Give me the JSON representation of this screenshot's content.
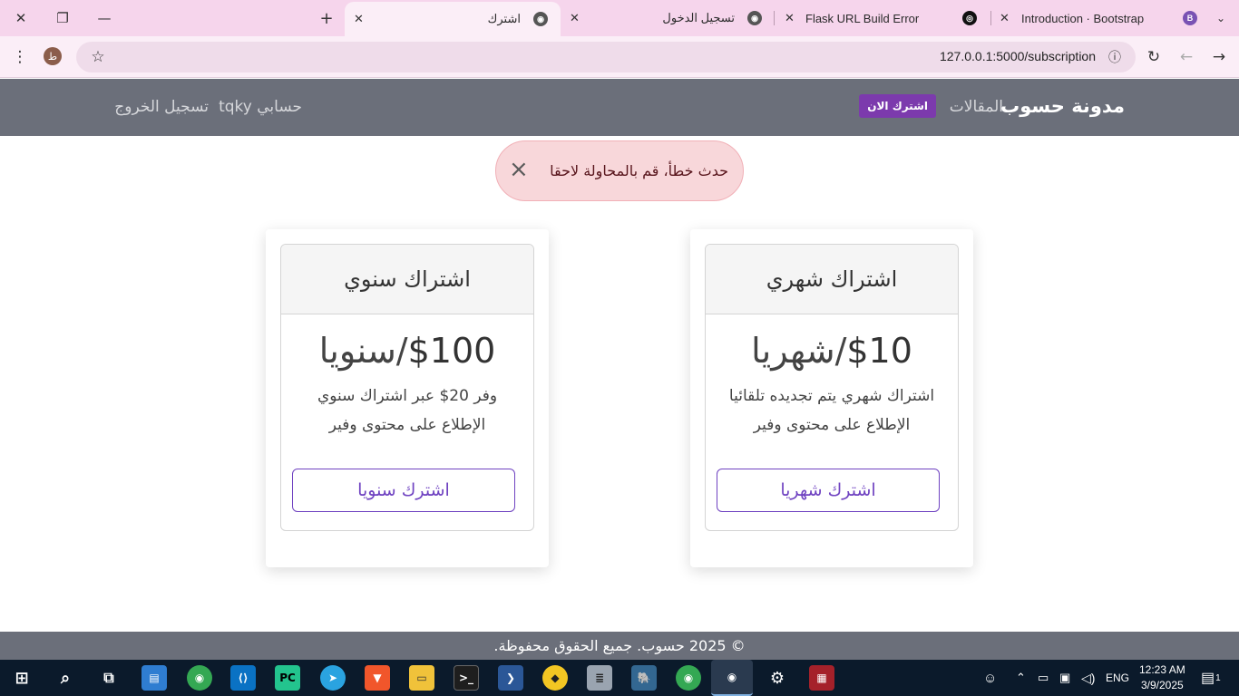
{
  "browser": {
    "tabs": [
      {
        "title": "اشترك",
        "active": true
      },
      {
        "title": "تسجيل الدخول",
        "active": false
      },
      {
        "title": "Flask URL Build Error",
        "active": false
      },
      {
        "title": "Introduction · Bootstrap",
        "active": false
      }
    ],
    "url": "127.0.0.1:5000/subscription",
    "profile_initial": "ط"
  },
  "navbar": {
    "brand": "مدونة حسوب",
    "articles": "المقالات",
    "subscribe_now": "اشترك الان",
    "account": "حسابي tqky",
    "logout": "تسجيل الخروج"
  },
  "alert": {
    "message": "حدث خطأ، قم بالمحاولة لاحقا",
    "close": "×"
  },
  "plans": {
    "monthly": {
      "title": "اشتراك شهري",
      "price": "$10",
      "period": "/شهريا",
      "features": [
        "اشتراك شهري يتم تجديده تلقائيا",
        "الإطلاع على محتوى وفير"
      ],
      "button": "اشترك شهريا"
    },
    "yearly": {
      "title": "اشتراك سنوي",
      "price": "$100",
      "period": "/سنويا",
      "features": [
        "وفر 20$ عبر اشتراك سنوي",
        "الإطلاع على محتوى وفير"
      ],
      "button": "اشترك سنويا"
    }
  },
  "footer": {
    "text": "© 2025 حسوب. جميع الحقوق محفوظة."
  },
  "taskbar": {
    "language": "ENG",
    "time": "12:23 AM",
    "date": "3/9/2025",
    "notifications": "1"
  },
  "colors": {
    "navbar": "#6b6f7a",
    "accent": "#6f42c1",
    "alert_bg": "#f8d7da",
    "tabstrip": "#f6d5ec"
  }
}
